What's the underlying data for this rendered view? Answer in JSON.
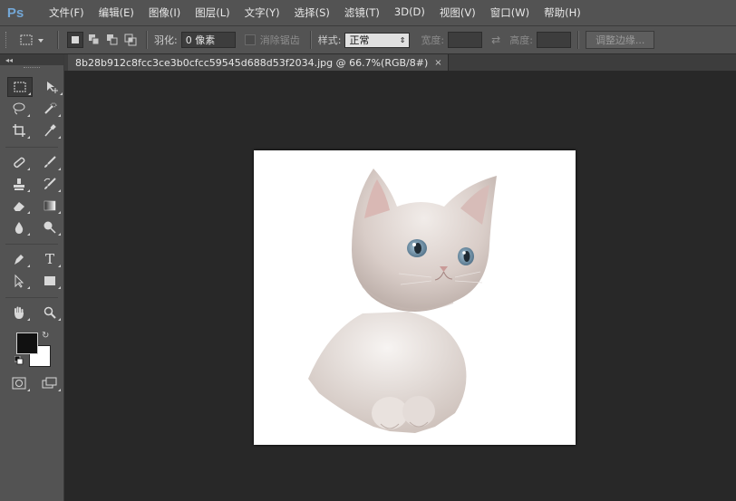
{
  "app": {
    "logo": "Ps"
  },
  "menu": [
    "文件(F)",
    "编辑(E)",
    "图像(I)",
    "图层(L)",
    "文字(Y)",
    "选择(S)",
    "滤镜(T)",
    "3D(D)",
    "视图(V)",
    "窗口(W)",
    "帮助(H)"
  ],
  "options": {
    "feather_label": "羽化:",
    "feather_value": "0 像素",
    "antialias_label": "消除锯齿",
    "style_label": "样式:",
    "style_value": "正常",
    "width_label": "宽度:",
    "height_label": "高度:",
    "refine_edge_label": "调整边缘..."
  },
  "document": {
    "tab_title": "8b28b912c8fcc3ce3b0cfcc59545d688d53f2034.jpg @ 66.7%(RGB/8#)",
    "close": "×"
  },
  "toolbox": {
    "collapse": "◂◂",
    "type_tool_glyph": "T",
    "tools": [
      "rectangular-marquee",
      "move",
      "lasso",
      "quick-selection",
      "crop",
      "eyedropper",
      "spot-healing-brush",
      "brush",
      "clone-stamp",
      "history-brush",
      "eraser",
      "gradient",
      "blur",
      "dodge",
      "pen",
      "type",
      "path-selection",
      "rectangle",
      "hand",
      "zoom"
    ],
    "foreground_color": "#111111",
    "background_color": "#ffffff"
  },
  "colors": {
    "chrome": "#535353",
    "workspace": "#282828",
    "accent": "#73a7d6"
  }
}
